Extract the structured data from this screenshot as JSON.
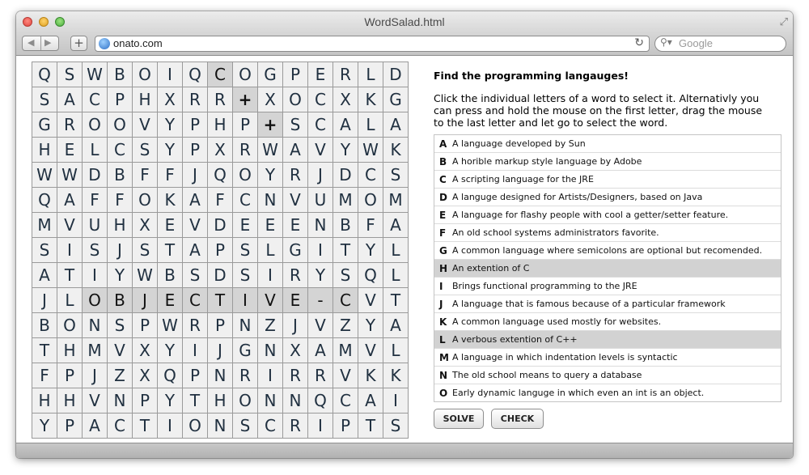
{
  "window": {
    "title": "WordSalad.html"
  },
  "toolbar": {
    "back_icon": "◀",
    "forward_icon": "▶",
    "plus_label": "+",
    "url": "onato.com",
    "reload_icon": "↻",
    "search_placeholder": "Google"
  },
  "grid": {
    "rows": [
      [
        "Q",
        "S",
        "W",
        "B",
        "O",
        "I",
        "Q",
        "C",
        "O",
        "G",
        "P",
        "E",
        "R",
        "L",
        "D"
      ],
      [
        "S",
        "A",
        "C",
        "P",
        "H",
        "X",
        "R",
        "R",
        "+",
        "X",
        "O",
        "C",
        "X",
        "K",
        "G"
      ],
      [
        "G",
        "R",
        "O",
        "O",
        "V",
        "Y",
        "P",
        "H",
        "P",
        "+",
        "S",
        "C",
        "A",
        "L",
        "A"
      ],
      [
        "H",
        "E",
        "L",
        "C",
        "S",
        "Y",
        "P",
        "X",
        "R",
        "W",
        "A",
        "V",
        "Y",
        "W",
        "K"
      ],
      [
        "W",
        "W",
        "D",
        "B",
        "F",
        "F",
        "J",
        "Q",
        "O",
        "Y",
        "R",
        "J",
        "D",
        "C",
        "S"
      ],
      [
        "Q",
        "A",
        "F",
        "F",
        "O",
        "K",
        "A",
        "F",
        "C",
        "N",
        "V",
        "U",
        "M",
        "O",
        "M"
      ],
      [
        "M",
        "V",
        "U",
        "H",
        "X",
        "E",
        "V",
        "D",
        "E",
        "E",
        "E",
        "N",
        "B",
        "F",
        "A"
      ],
      [
        "S",
        "I",
        "S",
        "J",
        "S",
        "T",
        "A",
        "P",
        "S",
        "L",
        "G",
        "I",
        "T",
        "Y",
        "L"
      ],
      [
        "A",
        "T",
        "I",
        "Y",
        "W",
        "B",
        "S",
        "D",
        "S",
        "I",
        "R",
        "Y",
        "S",
        "Q",
        "L"
      ],
      [
        "J",
        "L",
        "O",
        "B",
        "J",
        "E",
        "C",
        "T",
        "I",
        "V",
        "E",
        "-",
        "C",
        "V",
        "T"
      ],
      [
        "B",
        "O",
        "N",
        "S",
        "P",
        "W",
        "R",
        "P",
        "N",
        "Z",
        "J",
        "V",
        "Z",
        "Y",
        "A"
      ],
      [
        "T",
        "H",
        "M",
        "V",
        "X",
        "Y",
        "I",
        "J",
        "G",
        "N",
        "X",
        "A",
        "M",
        "V",
        "L"
      ],
      [
        "F",
        "P",
        "J",
        "Z",
        "X",
        "Q",
        "P",
        "N",
        "R",
        "I",
        "R",
        "R",
        "V",
        "K",
        "K"
      ],
      [
        "H",
        "H",
        "V",
        "N",
        "P",
        "Y",
        "T",
        "H",
        "O",
        "N",
        "N",
        "Q",
        "C",
        "A",
        "I"
      ],
      [
        "Y",
        "P",
        "A",
        "C",
        "T",
        "I",
        "O",
        "N",
        "S",
        "C",
        "R",
        "I",
        "P",
        "T",
        "S"
      ]
    ],
    "highlighted": [
      [
        0,
        7
      ],
      [
        1,
        8
      ],
      [
        2,
        9
      ],
      [
        9,
        2
      ],
      [
        9,
        3
      ],
      [
        9,
        4
      ],
      [
        9,
        5
      ],
      [
        9,
        6
      ],
      [
        9,
        7
      ],
      [
        9,
        8
      ],
      [
        9,
        9
      ],
      [
        9,
        10
      ],
      [
        9,
        11
      ],
      [
        9,
        12
      ]
    ]
  },
  "panel": {
    "title": "Find the programming langauges!",
    "instructions": "Click the individual letters of a word to select it. Alternativly you can press and hold the mouse on the first letter, drag the mouse to the last letter and let go to select the word.",
    "clues": [
      {
        "letter": "A",
        "text": "A language developed by Sun",
        "selected": false
      },
      {
        "letter": "B",
        "text": "A horible markup style language by Adobe",
        "selected": false
      },
      {
        "letter": "C",
        "text": "A scripting language for the JRE",
        "selected": false
      },
      {
        "letter": "D",
        "text": "A languge designed for Artists/Designers, based on Java",
        "selected": false
      },
      {
        "letter": "E",
        "text": "A language for flashy people with cool a getter/setter feature.",
        "selected": false
      },
      {
        "letter": "F",
        "text": "An old school systems administrators favorite.",
        "selected": false
      },
      {
        "letter": "G",
        "text": "A common language where semicolons are optional but recomended.",
        "selected": false
      },
      {
        "letter": "H",
        "text": "An extention of C",
        "selected": true
      },
      {
        "letter": "I",
        "text": "Brings functional programming to the JRE",
        "selected": false
      },
      {
        "letter": "J",
        "text": "A language that is famous because of a particular framework",
        "selected": false
      },
      {
        "letter": "K",
        "text": "A common language used mostly for websites.",
        "selected": false
      },
      {
        "letter": "L",
        "text": "A verbous extention of C++",
        "selected": true
      },
      {
        "letter": "M",
        "text": "A language in which indentation levels is syntactic",
        "selected": false
      },
      {
        "letter": "N",
        "text": "The old school means to query a database",
        "selected": false
      },
      {
        "letter": "O",
        "text": "Early dynamic languge in which even an int is an object.",
        "selected": false
      }
    ],
    "solve_label": "SOLVE",
    "check_label": "CHECK"
  }
}
